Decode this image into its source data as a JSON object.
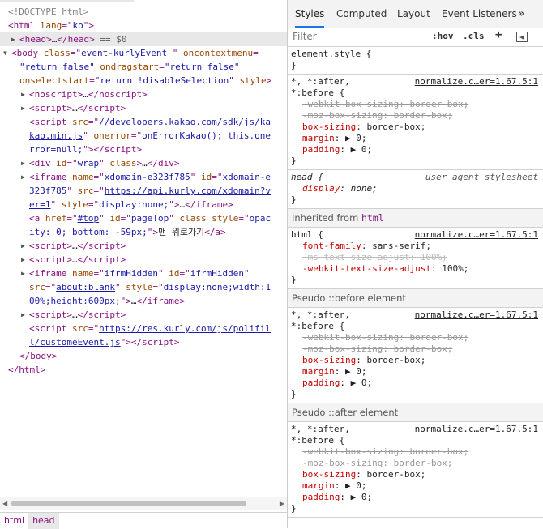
{
  "elements": {
    "lines": [
      {
        "html": "<span class=\"cm\">&lt;!DOCTYPE html&gt;</span>"
      },
      {
        "html": "<span class=\"tag\">&lt;html</span> <span class=\"attr\">lang</span><span class=\"tag\">=\"</span><span class=\"val\">ko</span><span class=\"tag\">\"&gt;</span>"
      },
      {
        "sel": true,
        "tri": "right",
        "html": "<span class=\"tag\">&lt;head&gt;</span><span class=\"txt\">…</span><span class=\"tag\">&lt;/head&gt;</span> <span class=\"eq\">== $0</span>"
      },
      {
        "tri": "down",
        "html": "<span class=\"tag\">&lt;body</span> <span class=\"attr\">class</span><span class=\"tag\">=\"</span><span class=\"val\">event-kurlyEvent </span><span class=\"tag\">\"</span> <span class=\"attr\">oncontextmenu</span><span class=\"tag\">=</span>"
      },
      {
        "html": "<span class=\"val\">\"return false\"</span> <span class=\"attr\">ondragstart</span><span class=\"tag\">=</span><span class=\"val\">\"return false\"</span>"
      },
      {
        "html": "<span class=\"attr\">onselectstart</span><span class=\"tag\">=</span><span class=\"val\">\"return !disableSelection\"</span> <span class=\"attr\">style</span><span class=\"tag\">&gt;</span>"
      },
      {
        "tri": "right",
        "html": "<span class=\"tag\">&lt;noscript&gt;</span><span class=\"txt\">…</span><span class=\"tag\">&lt;/noscript&gt;</span>"
      },
      {
        "tri": "right",
        "html": "<span class=\"tag\">&lt;script&gt;</span><span class=\"txt\">…</span><span class=\"tag\">&lt;/script&gt;</span>"
      },
      {
        "html": "<span class=\"tag\">&lt;script</span> <span class=\"attr\">src</span><span class=\"tag\">=\"</span><span class=\"link\">//developers.kakao.com/sdk/js/ka</span>"
      },
      {
        "html": "<span class=\"link\">kao.min.js</span><span class=\"tag\">\"</span> <span class=\"attr\">onerror</span><span class=\"tag\">=\"</span><span class=\"val\">onErrorKakao(); this.one</span>"
      },
      {
        "html": "<span class=\"val\">rror=null;</span><span class=\"tag\">\"&gt;&lt;/script&gt;</span>"
      },
      {
        "tri": "right",
        "html": "<span class=\"tag\">&lt;div</span> <span class=\"attr\">id</span><span class=\"tag\">=\"</span><span class=\"val\">wrap</span><span class=\"tag\">\"</span> <span class=\"attr\">class</span><span class=\"tag\">&gt;</span><span class=\"txt\">…</span><span class=\"tag\">&lt;/div&gt;</span>"
      },
      {
        "tri": "right",
        "html": "<span class=\"tag\">&lt;iframe</span> <span class=\"attr\">name</span><span class=\"tag\">=\"</span><span class=\"val\">xdomain-e323f785</span><span class=\"tag\">\"</span> <span class=\"attr\">id</span><span class=\"tag\">=\"</span><span class=\"val\">xdomain-e</span>"
      },
      {
        "html": "<span class=\"val\">323f785</span><span class=\"tag\">\"</span> <span class=\"attr\">src</span><span class=\"tag\">=\"</span><span class=\"link\">https://api.kurly.com/xdomain?v</span>"
      },
      {
        "html": "<span class=\"link\">er=1</span><span class=\"tag\">\"</span> <span class=\"attr\">style</span><span class=\"tag\">=\"</span><span class=\"val\">display:none;</span><span class=\"tag\">\"&gt;</span><span class=\"txt\">…</span><span class=\"tag\">&lt;/iframe&gt;</span>"
      },
      {
        "html": "<span class=\"tag\">&lt;a</span> <span class=\"attr\">href</span><span class=\"tag\">=\"</span><span class=\"link\">#top</span><span class=\"tag\">\"</span> <span class=\"attr\">id</span><span class=\"tag\">=\"</span><span class=\"val\">pageTop</span><span class=\"tag\">\"</span> <span class=\"attr\">class</span> <span class=\"attr\">style</span><span class=\"tag\">=\"</span><span class=\"val\">opac</span>"
      },
      {
        "html": "<span class=\"val\">ity: 0; bottom: -59px;</span><span class=\"tag\">\"&gt;</span><span class=\"txt\">맨 위로가기</span><span class=\"tag\">&lt;/a&gt;</span>"
      },
      {
        "tri": "right",
        "html": "<span class=\"tag\">&lt;script&gt;</span><span class=\"txt\">…</span><span class=\"tag\">&lt;/script&gt;</span>"
      },
      {
        "tri": "right",
        "html": "<span class=\"tag\">&lt;script&gt;</span><span class=\"txt\">…</span><span class=\"tag\">&lt;/script&gt;</span>"
      },
      {
        "tri": "right",
        "html": "<span class=\"tag\">&lt;iframe</span> <span class=\"attr\">name</span><span class=\"tag\">=\"</span><span class=\"val\">ifrmHidden</span><span class=\"tag\">\"</span> <span class=\"attr\">id</span><span class=\"tag\">=\"</span><span class=\"val\">ifrmHidden</span><span class=\"tag\">\"</span>"
      },
      {
        "html": "<span class=\"attr\">src</span><span class=\"tag\">=\"</span><span class=\"link\">about:blank</span><span class=\"tag\">\"</span> <span class=\"attr\">style</span><span class=\"tag\">=\"</span><span class=\"val\">display:none;width:1</span>"
      },
      {
        "html": "<span class=\"val\">00%;height:600px;</span><span class=\"tag\">\"&gt;</span><span class=\"txt\">…</span><span class=\"tag\">&lt;/iframe&gt;</span>"
      },
      {
        "tri": "right",
        "html": "<span class=\"tag\">&lt;script&gt;</span><span class=\"txt\">…</span><span class=\"tag\">&lt;/script&gt;</span>"
      },
      {
        "html": "<span class=\"tag\">&lt;script</span> <span class=\"attr\">src</span><span class=\"tag\">=\"</span><span class=\"link\">https://res.kurly.com/js/polifil</span>"
      },
      {
        "html": "<span class=\"link\">l/customeEvent.js</span><span class=\"tag\">\"&gt;&lt;/script&gt;</span>"
      },
      {
        "html": "<span class=\"tag\">&lt;/body&gt;</span>"
      },
      {
        "html": "<span class=\"tag\">&lt;/html&gt;</span>"
      }
    ],
    "indents": [
      10,
      10,
      22,
      14,
      24,
      24,
      36,
      36,
      36,
      36,
      36,
      36,
      36,
      36,
      36,
      36,
      36,
      36,
      36,
      36,
      36,
      36,
      36,
      36,
      36,
      24,
      10
    ],
    "breadcrumbs": [
      "html",
      "head"
    ]
  },
  "styles": {
    "tabs": [
      "Styles",
      "Computed",
      "Layout",
      "Event Listeners",
      "»"
    ],
    "filter_placeholder": "Filter",
    "hov": ":hov",
    "cls": ".cls",
    "plus": "+",
    "source": "normalize.c…er=1.67.5:1",
    "user_agent": "user agent stylesheet",
    "element_style": "element.style {",
    "close": "}",
    "universal_selector_1": "*, *:after,",
    "universal_selector_2": "*:before {",
    "head_selector": "head {",
    "html_selector": "html {",
    "inherited_label": "Inherited from ",
    "inherited_tag": "html",
    "pseudo_before": "Pseudo ::before element",
    "pseudo_after": "Pseudo ::after element",
    "decls": {
      "webkit_box_sizing": "-webkit-box-sizing: border-box;",
      "moz_box_sizing": "-moz-box-sizing: border-box;",
      "box_sizing_prop": "box-sizing",
      "box_sizing_val": ": border-box;",
      "margin_prop": "margin",
      "margin_val": ": ▶ 0;",
      "padding_prop": "padding",
      "padding_val": ": ▶ 0;",
      "display_prop": "display",
      "display_val": ": none;",
      "font_family_prop": "font-family",
      "font_family_val": ": sans-serif;",
      "ms_text": "-ms-text-size-adjust: 100%;",
      "webkit_text_prop": "-webkit-text-size-adjust",
      "webkit_text_val": ": 100%;"
    }
  }
}
